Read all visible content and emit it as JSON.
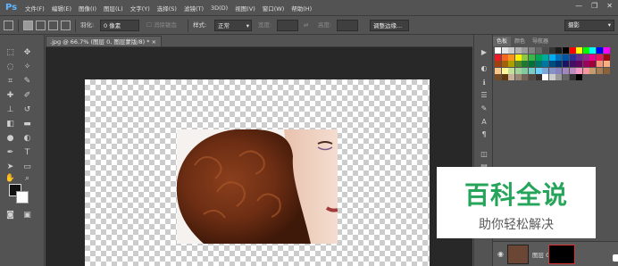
{
  "app": {
    "logo": "Ps"
  },
  "menu": [
    "文件(F)",
    "编辑(E)",
    "图像(I)",
    "图层(L)",
    "文字(Y)",
    "选择(S)",
    "滤镜(T)",
    "3D(D)",
    "视图(V)",
    "窗口(W)",
    "帮助(H)"
  ],
  "window_controls": {
    "minimize": "—",
    "restore": "❐",
    "close": "✕"
  },
  "options": {
    "feather_label": "羽化:",
    "feather_value": "0 像素",
    "antialias_label": "消除锯齿",
    "style_label": "样式:",
    "style_value": "正常",
    "width_label": "宽度:",
    "swap_icon": "⇄",
    "height_label": "高度:",
    "refine_edge_button": "调整边缘...",
    "workspace": "摄影"
  },
  "document": {
    "tab_label": ".jpg @ 66.7% (图层 0, 图层蒙版/8) *",
    "close": "×"
  },
  "panel": {
    "tabs": [
      "色板",
      "颜色",
      "导航器"
    ]
  },
  "swatch_colors": [
    "#ffffff",
    "#e6e6e6",
    "#cccccc",
    "#b3b3b3",
    "#999999",
    "#808080",
    "#666666",
    "#4d4d4d",
    "#333333",
    "#1a1a1a",
    "#000000",
    "#ff0000",
    "#ffff00",
    "#00ff00",
    "#00ffff",
    "#0000ff",
    "#ff00ff",
    "#ed1c24",
    "#f26522",
    "#f7941d",
    "#fff200",
    "#8dc63f",
    "#39b54a",
    "#00a651",
    "#00a99d",
    "#00aeef",
    "#0072bc",
    "#0054a6",
    "#2e3192",
    "#662d91",
    "#92278f",
    "#ec008c",
    "#ed145b",
    "#9e0b0f",
    "#a0410d",
    "#a36209",
    "#aba000",
    "#598527",
    "#1a7b30",
    "#007236",
    "#00746b",
    "#0076a3",
    "#004b80",
    "#003471",
    "#1b1464",
    "#440e62",
    "#630460",
    "#9e005d",
    "#9e0039",
    "#f69679",
    "#f9ad81",
    "#fdc68a",
    "#fff799",
    "#c4df9b",
    "#a3d39c",
    "#82ca9d",
    "#7accc8",
    "#6dcff6",
    "#7da7d9",
    "#8393ca",
    "#8781bd",
    "#a187be",
    "#bd8cbf",
    "#f49ac2",
    "#f6989d",
    "#c69c6d",
    "#a67c52",
    "#8c6239",
    "#754c24",
    "#603913",
    "#c7b299",
    "#998675",
    "#736357",
    "#534741",
    "#362f2d",
    "#ffffff",
    "#cccccc",
    "#999999",
    "#666666",
    "#333333",
    "#000000"
  ],
  "watermark": {
    "title": "百科全说",
    "subtitle": "助你轻松解决"
  },
  "layers": {
    "layer_name": "图层 0"
  }
}
